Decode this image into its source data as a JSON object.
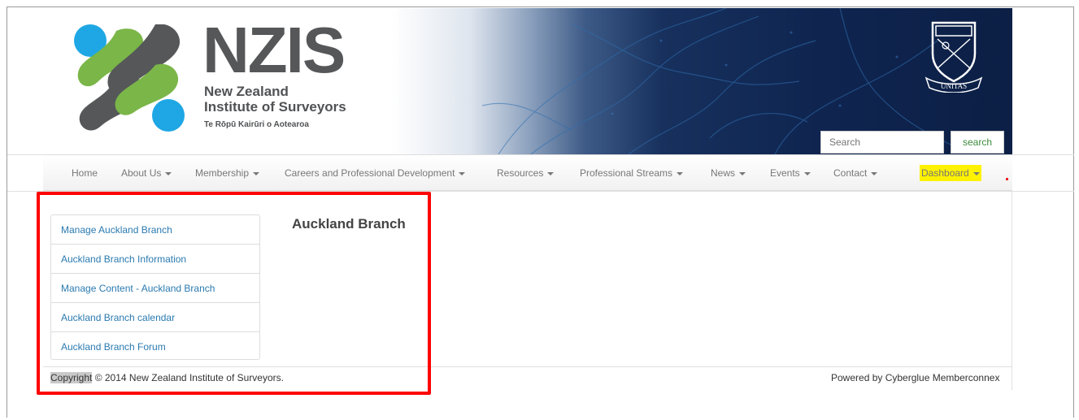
{
  "header": {
    "logo_text": "NZIS",
    "org_name_line1": "New Zealand",
    "org_name_line2": "Institute of Surveyors",
    "org_maori": "Te Rōpū Kairūri o Aotearoa",
    "crest_motto": "UNITAS",
    "search_placeholder": "Search",
    "search_button": "search"
  },
  "nav": {
    "items": [
      {
        "label": "Home",
        "dropdown": false
      },
      {
        "label": "About Us",
        "dropdown": true
      },
      {
        "label": "Membership",
        "dropdown": true
      },
      {
        "label": "Careers and Professional Development",
        "dropdown": true
      },
      {
        "label": "Resources",
        "dropdown": true
      },
      {
        "label": "Professional Streams",
        "dropdown": true
      },
      {
        "label": "News",
        "dropdown": true
      },
      {
        "label": "Events",
        "dropdown": true
      },
      {
        "label": "Contact",
        "dropdown": true
      },
      {
        "label": "Dashboard",
        "dropdown": true,
        "highlighted": true
      }
    ]
  },
  "sidebar": {
    "items": [
      {
        "label": "Manage Auckland Branch"
      },
      {
        "label": "Auckland Branch Information"
      },
      {
        "label": "Manage Content - Auckland Branch"
      },
      {
        "label": "Auckland Branch calendar"
      },
      {
        "label": "Auckland Branch Forum"
      }
    ]
  },
  "main": {
    "title": "Auckland Branch"
  },
  "footer": {
    "copyright_word": "Copyright",
    "copyright_rest": " © 2014 New Zealand Institute of Surveyors.",
    "powered_by": "Powered by Cyberglue Memberconnex"
  },
  "colors": {
    "link": "#2a7ab0",
    "highlight": "#fff200",
    "annotation": "#ff0000",
    "logo_green": "#7ab648",
    "logo_blue": "#1ea7e4",
    "logo_gray": "#555759",
    "banner_navy": "#0f2550"
  }
}
